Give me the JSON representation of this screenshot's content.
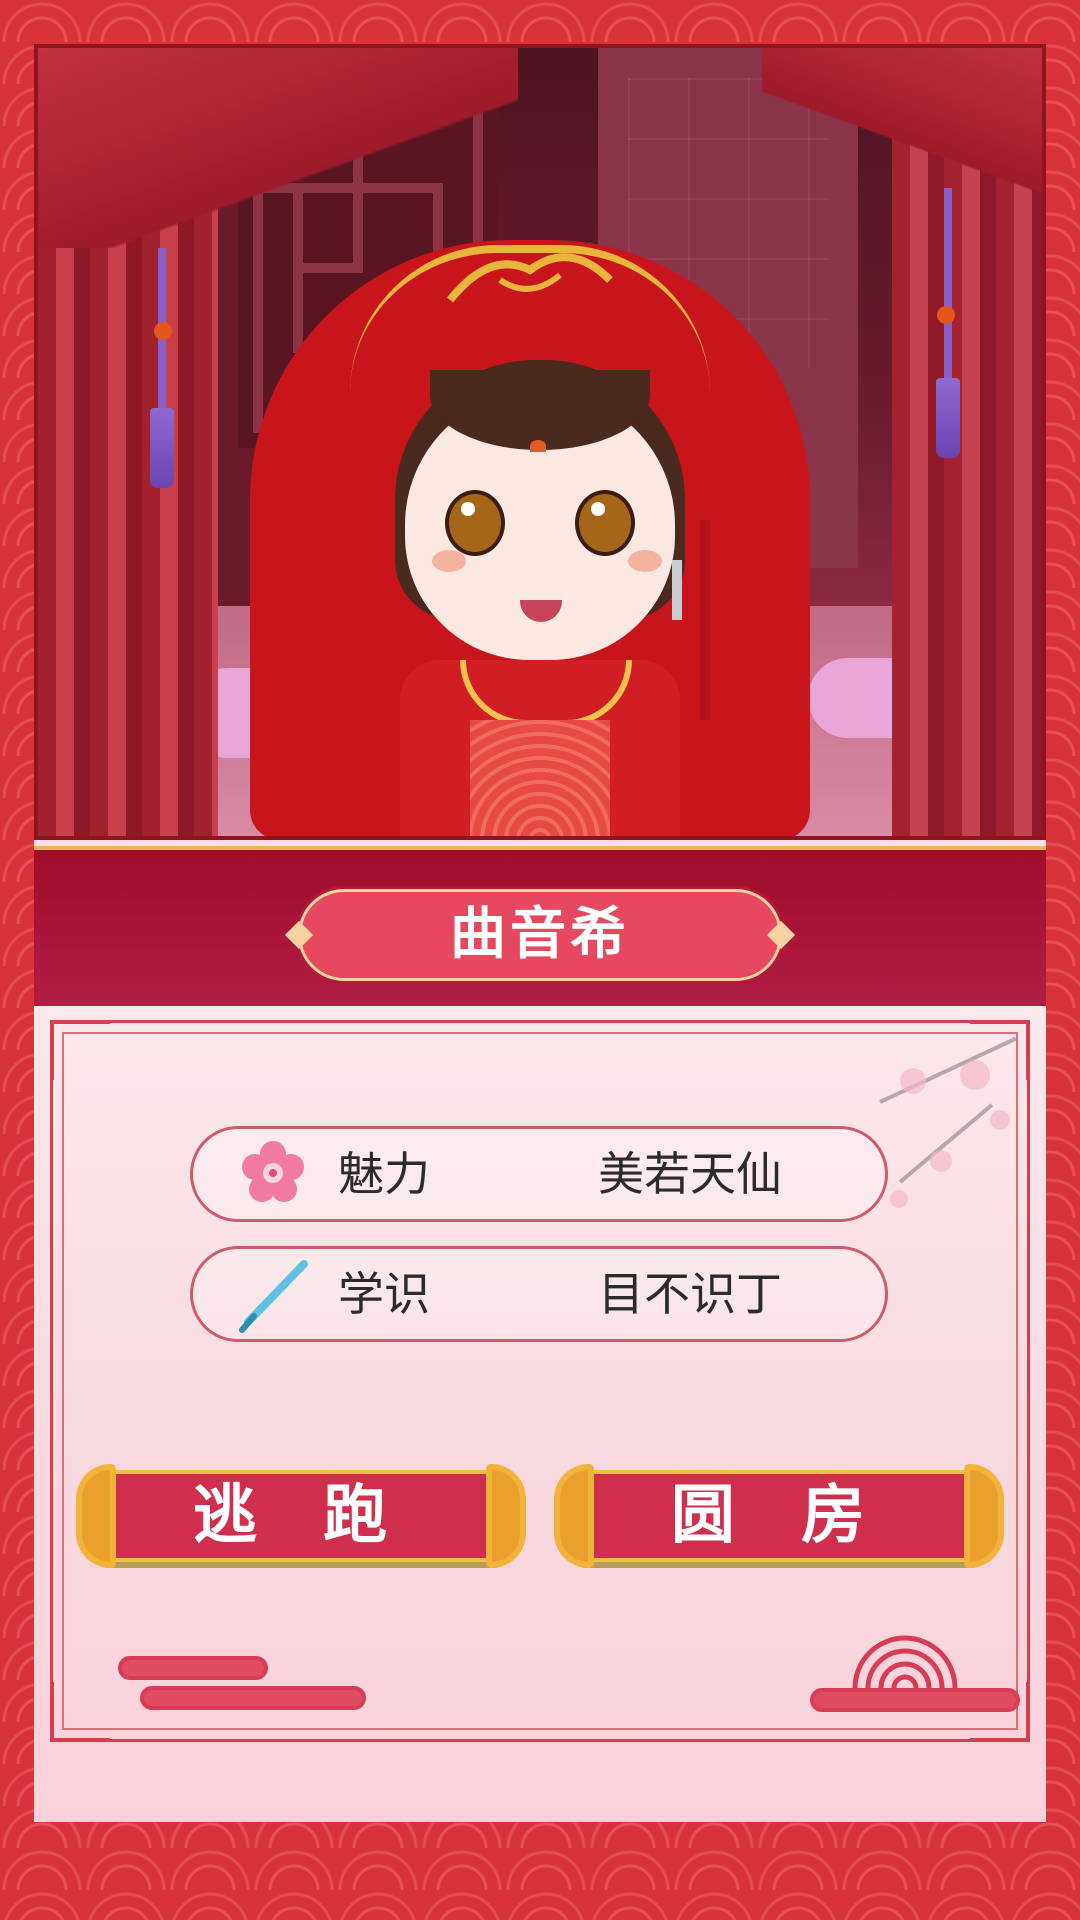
{
  "character": {
    "name": "曲音希"
  },
  "stats": [
    {
      "icon": "plum-blossom-icon",
      "label": "魅力",
      "value": "美若天仙"
    },
    {
      "icon": "brush-icon",
      "label": "学识",
      "value": "目不识丁"
    }
  ],
  "actions": {
    "escape_label": "逃 跑",
    "consummate_label": "圆 房"
  },
  "colors": {
    "background": "#d8323a",
    "banner": "#a10c2a",
    "name_plate": "#e6485f",
    "button": "#cf2f4c",
    "gold_trim": "#f1c04a",
    "panel": "#fbe9ec"
  }
}
